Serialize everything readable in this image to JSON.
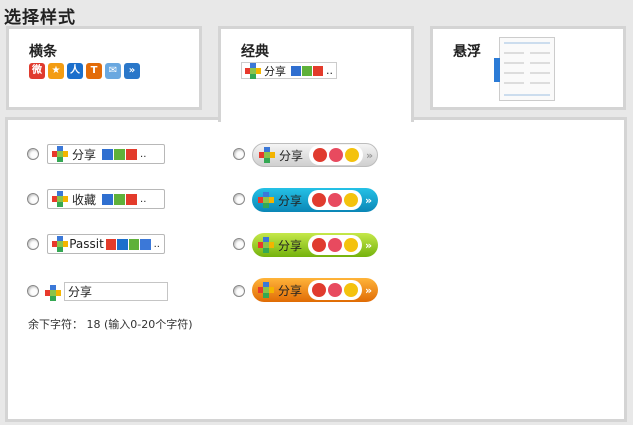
{
  "page_title": "选择样式",
  "tabs": [
    {
      "label": "横条",
      "selected": false
    },
    {
      "label": "经典",
      "selected": true
    },
    {
      "label": "悬浮",
      "selected": false
    }
  ],
  "classic_preview": {
    "share_label": "分享"
  },
  "options": {
    "left": [
      {
        "label": "分享",
        "selected": false
      },
      {
        "label": "收藏",
        "selected": false
      },
      {
        "label": "Passit",
        "selected": false
      },
      {
        "label": "分享",
        "selected": false
      }
    ],
    "right": [
      {
        "label": "分享",
        "style": "gray",
        "selected": false
      },
      {
        "label": "分享",
        "style": "blue",
        "selected": false
      },
      {
        "label": "分享",
        "style": "green",
        "selected": false
      },
      {
        "label": "分享",
        "style": "orange",
        "selected": false
      }
    ]
  },
  "text_input": {
    "value": "分享"
  },
  "remaining": "余下字符： 18 (输入0-20个字符)",
  "more_glyph": "..",
  "arrow_glyph": "»",
  "colors": {
    "tab_border": "#d4d4d4",
    "pill_gray": "#cfcfcf",
    "pill_blue": "#0a86b6",
    "pill_green": "#74b20d",
    "pill_orange": "#e06b05"
  },
  "icons": [
    "weibo-icon",
    "star-icon",
    "renren-icon",
    "tieba-icon",
    "email-icon",
    "more-icon",
    "share-plus-icon",
    "windows-icon",
    "kaixin-icon"
  ]
}
